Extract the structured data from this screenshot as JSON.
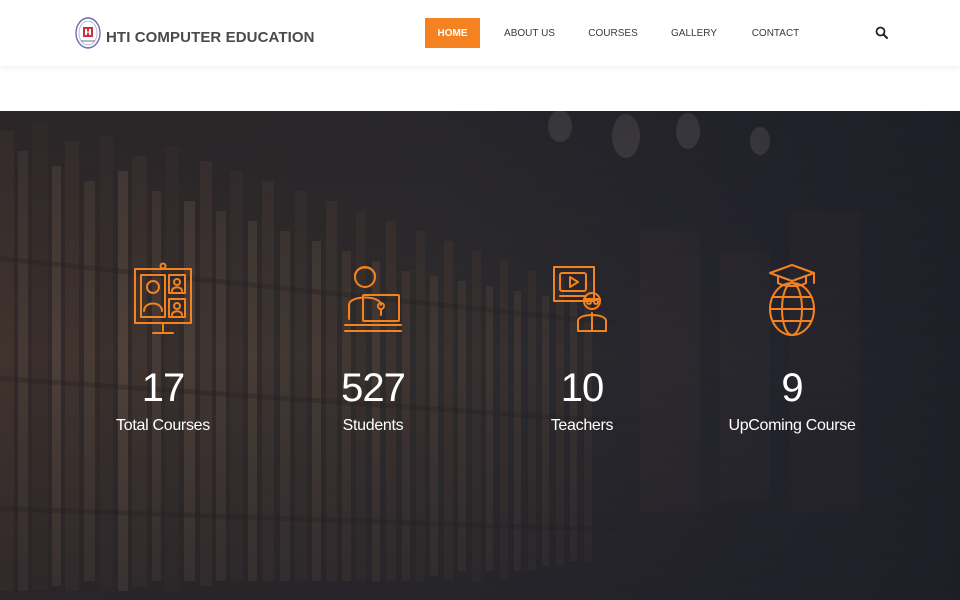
{
  "brand": {
    "name": "HTI COMPUTER EDUCATION",
    "logo_icon": "hti-logo-icon"
  },
  "nav": {
    "items": [
      {
        "label": "HOME",
        "active": true
      },
      {
        "label": "ABOUT US",
        "active": false
      },
      {
        "label": "COURSES",
        "active": false
      },
      {
        "label": "GALLERY",
        "active": false
      },
      {
        "label": "CONTACT",
        "active": false
      }
    ],
    "search_icon": "search-icon"
  },
  "colors": {
    "accent": "#f58220",
    "hero_overlay": "#25252d",
    "text_dark": "#3a3a3a",
    "white": "#ffffff"
  },
  "stats": [
    {
      "value": "17",
      "label": "Total Courses",
      "icon": "video-conference-icon"
    },
    {
      "value": "527",
      "label": "Students",
      "icon": "student-laptop-icon"
    },
    {
      "value": "10",
      "label": "Teachers",
      "icon": "video-teacher-icon"
    },
    {
      "value": "9",
      "label": "UpComing Course",
      "icon": "graduation-globe-icon"
    }
  ]
}
